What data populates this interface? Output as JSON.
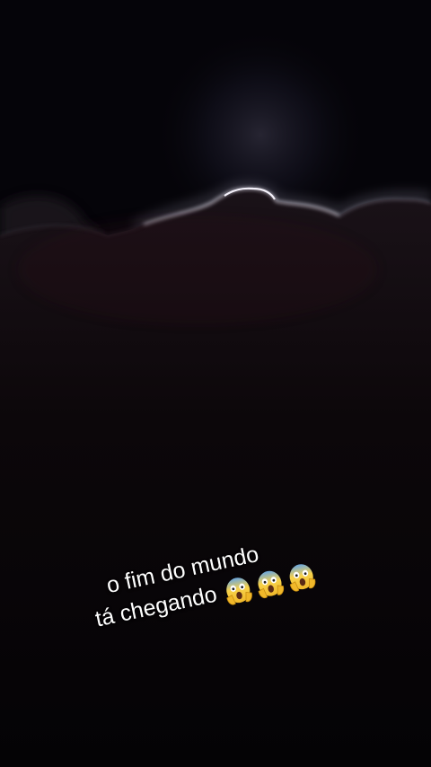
{
  "caption": {
    "line1": "o fim do mundo",
    "line2": "tá chegando",
    "emoji": [
      "screaming-face-icon",
      "screaming-face-icon",
      "screaming-face-icon"
    ]
  },
  "colors": {
    "sky": "#040306",
    "cloud_silver_lining": "#e8e4ee",
    "cloud_body": "#0d080c",
    "emoji_yellow": "#f5c431",
    "emoji_blue": "#6aa7e0"
  }
}
